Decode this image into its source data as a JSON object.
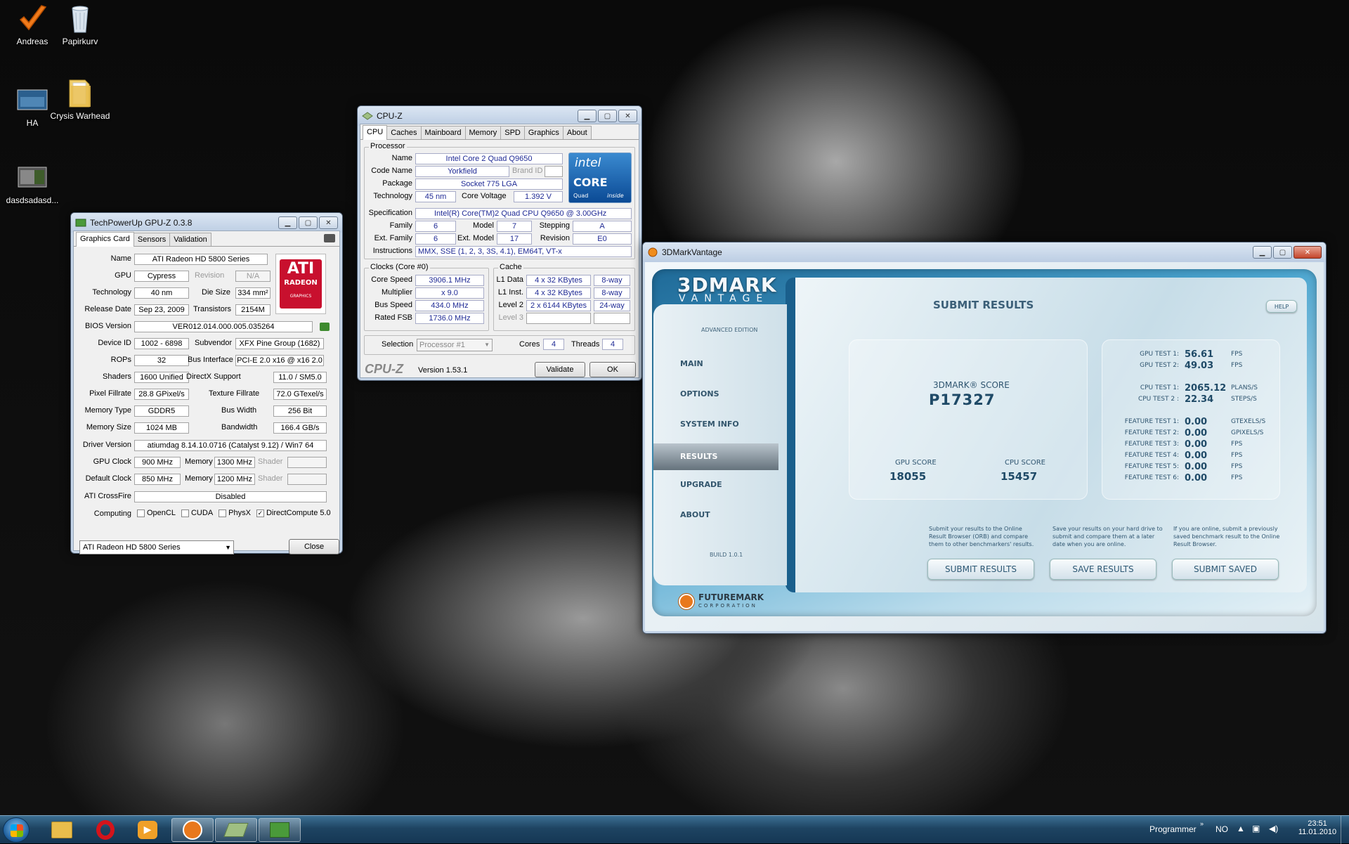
{
  "desktop": {
    "icons": [
      {
        "label": "Andreas",
        "icon": "check-icon"
      },
      {
        "label": "Papirkurv",
        "icon": "recycle-bin-icon"
      },
      {
        "label": "HA",
        "icon": "image-thumbnail-icon"
      },
      {
        "label": "Crysis Warhead",
        "icon": "folder-icon"
      },
      {
        "label": "dasdsadasd...",
        "icon": "image-thumbnail-icon"
      }
    ]
  },
  "gpuz": {
    "title": "TechPowerUp GPU-Z 0.3.8",
    "tabs": [
      "Graphics Card",
      "Sensors",
      "Validation"
    ],
    "logo_lines": [
      "ATI",
      "RADEON",
      "GRAPHICS"
    ],
    "name_label": "Name",
    "name": "ATI Radeon HD 5800 Series",
    "gpu_label": "GPU",
    "gpu": "Cypress",
    "revision_label": "Revision",
    "revision": "N/A",
    "tech_label": "Technology",
    "tech": "40 nm",
    "die_label": "Die Size",
    "die": "334 mm²",
    "release_label": "Release Date",
    "release": "Sep 23, 2009",
    "trans_label": "Transistors",
    "trans": "2154M",
    "bios_label": "BIOS Version",
    "bios": "VER012.014.000.005.035264",
    "devid_label": "Device ID",
    "devid": "1002 - 6898",
    "subv_label": "Subvendor",
    "subv": "XFX Pine Group (1682)",
    "rops_label": "ROPs",
    "rops": "32",
    "bus_label": "Bus Interface",
    "bus": "PCI-E 2.0 x16 @ x16 2.0",
    "shaders_label": "Shaders",
    "shaders": "1600 Unified",
    "dx_label": "DirectX Support",
    "dx": "11.0 / SM5.0",
    "pix_label": "Pixel Fillrate",
    "pix": "28.8 GPixel/s",
    "tex_label": "Texture Fillrate",
    "tex": "72.0 GTexel/s",
    "memtype_label": "Memory Type",
    "memtype": "GDDR5",
    "buswidth_label": "Bus Width",
    "buswidth": "256 Bit",
    "memsize_label": "Memory Size",
    "memsize": "1024 MB",
    "bw_label": "Bandwidth",
    "bw": "166.4 GB/s",
    "driver_label": "Driver Version",
    "driver": "atiumdag 8.14.10.0716 (Catalyst 9.12) / Win7 64",
    "gpuclock_label": "GPU Clock",
    "gpuclock": "900 MHz",
    "mem_label": "Memory",
    "gpumem": "1300 MHz",
    "shader_label": "Shader",
    "defclock_label": "Default Clock",
    "defclock": "850 MHz",
    "defmem": "1200 MHz",
    "crossfire_label": "ATI CrossFire",
    "crossfire": "Disabled",
    "computing_label": "Computing",
    "computing": [
      {
        "label": "OpenCL",
        "checked": false
      },
      {
        "label": "CUDA",
        "checked": false
      },
      {
        "label": "PhysX",
        "checked": false
      },
      {
        "label": "DirectCompute 5.0",
        "checked": true
      }
    ],
    "select": "ATI Radeon HD 5800 Series",
    "close": "Close"
  },
  "cpuz": {
    "title": "CPU-Z",
    "tabs": [
      "CPU",
      "Caches",
      "Mainboard",
      "Memory",
      "SPD",
      "Graphics",
      "About"
    ],
    "processor_group": "Processor",
    "name_label": "Name",
    "name": "Intel Core 2 Quad Q9650",
    "code_label": "Code Name",
    "code": "Yorkfield",
    "brand_label": "Brand ID",
    "pkg_label": "Package",
    "pkg": "Socket 775 LGA",
    "tech_label": "Technology",
    "tech": "45 nm",
    "volt_label": "Core Voltage",
    "volt": "1.392 V",
    "spec_label": "Specification",
    "spec": "Intel(R) Core(TM)2 Quad CPU    Q9650  @ 3.00GHz",
    "family_label": "Family",
    "family": "6",
    "model_label": "Model",
    "model": "7",
    "stepping_label": "Stepping",
    "stepping": "A",
    "extfam_label": "Ext. Family",
    "extfam": "6",
    "extmodel_label": "Ext. Model",
    "extmodel": "17",
    "revision_label": "Revision",
    "revision": "E0",
    "instr_label": "Instructions",
    "instr": "MMX, SSE (1, 2, 3, 3S, 4.1), EM64T, VT-x",
    "logo_lines": [
      "intel",
      "CORE",
      "Quad",
      "inside"
    ],
    "clocks_group": "Clocks (Core #0)",
    "corespeed_label": "Core Speed",
    "corespeed": "3906.1 MHz",
    "mult_label": "Multiplier",
    "mult": "x 9.0",
    "busspeed_label": "Bus Speed",
    "busspeed": "434.0 MHz",
    "fsb_label": "Rated FSB",
    "fsb": "1736.0 MHz",
    "cache_group": "Cache",
    "l1d_label": "L1 Data",
    "l1d": "4 x 32 KBytes",
    "l1d_way": "8-way",
    "l1i_label": "L1 Inst.",
    "l1i": "4 x 32 KBytes",
    "l1i_way": "8-way",
    "l2_label": "Level 2",
    "l2": "2 x 6144 KBytes",
    "l2_way": "24-way",
    "l3_label": "Level 3",
    "sel_label": "Selection",
    "sel": "Processor #1",
    "cores_label": "Cores",
    "cores": "4",
    "threads_label": "Threads",
    "threads": "4",
    "brand": "CPU-Z",
    "version": "Version 1.53.1",
    "validate": "Validate",
    "ok": "OK"
  },
  "vantage": {
    "title": "3DMarkVantage",
    "logo_top": "3DMARK",
    "logo_sub": "VANTAGE",
    "edition": "ADVANCED EDITION",
    "heading": "SUBMIT RESULTS",
    "help": "HELP",
    "menu": [
      "MAIN",
      "OPTIONS",
      "SYSTEM INFO",
      "RESULTS",
      "UPGRADE",
      "ABOUT"
    ],
    "active_menu": "RESULTS",
    "build": "BUILD 1.0.1",
    "score_label": "3DMARK® SCORE",
    "score": "P17327",
    "gpu_score_label": "GPU SCORE",
    "gpu_score": "18055",
    "cpu_score_label": "CPU SCORE",
    "cpu_score": "15457",
    "tests": [
      {
        "label": "GPU TEST 1:",
        "value": "56.61",
        "unit": "FPS"
      },
      {
        "label": "GPU TEST 2:",
        "value": "49.03",
        "unit": "FPS"
      },
      {
        "label": "CPU TEST 1:",
        "value": "2065.12",
        "unit": "PLANS/S"
      },
      {
        "label": "CPU TEST 2 :",
        "value": "22.34",
        "unit": "STEPS/S"
      },
      {
        "label": "FEATURE TEST 1:",
        "value": "0.00",
        "unit": "GTEXELS/S"
      },
      {
        "label": "FEATURE TEST 2:",
        "value": "0.00",
        "unit": "GPIXELS/S"
      },
      {
        "label": "FEATURE TEST 3:",
        "value": "0.00",
        "unit": "FPS"
      },
      {
        "label": "FEATURE TEST 4:",
        "value": "0.00",
        "unit": "FPS"
      },
      {
        "label": "FEATURE TEST 5:",
        "value": "0.00",
        "unit": "FPS"
      },
      {
        "label": "FEATURE TEST 6:",
        "value": "0.00",
        "unit": "FPS"
      }
    ],
    "desc_submit": "Submit your results to the Online Result Browser (ORB) and compare them to other benchmarkers' results.",
    "desc_save": "Save your results on your hard drive to submit and compare them at a later date when you are online.",
    "desc_saved": "If you are online, submit a previously saved benchmark result to the Online Result Browser.",
    "btn_submit": "SUBMIT RESULTS",
    "btn_save": "SAVE RESULTS",
    "btn_saved": "SUBMIT SAVED",
    "futuremark": "FUTUREMARK",
    "corporation": "CORPORATION"
  },
  "taskbar": {
    "programs_label": "Programmer",
    "lang": "NO",
    "time": "23:51",
    "date": "11.01.2010"
  }
}
